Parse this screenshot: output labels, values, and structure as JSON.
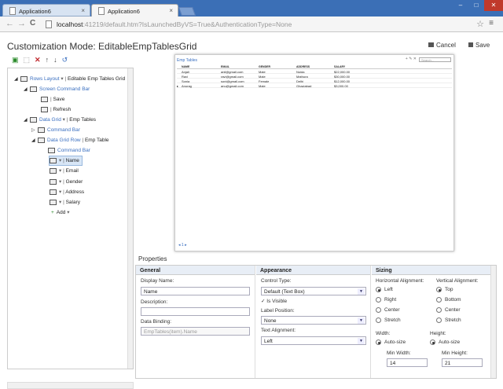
{
  "browser": {
    "tabs": [
      {
        "label": "Application6",
        "close": "×"
      },
      {
        "label": "Application6",
        "close": "×"
      }
    ],
    "url_host": "localhost",
    "url_rest": ":41219/default.htm?IsLaunchedByVS=True&AuthenticationType=None",
    "back": "←",
    "forward": "→",
    "reload": "C",
    "star": "☆",
    "menu": "≡",
    "win": {
      "min": "–",
      "max": "□",
      "close": "✕"
    }
  },
  "app": {
    "title": "Customization Mode: EditableEmpTablesGrid",
    "cancel": "Cancel",
    "save": "Save",
    "tree": {
      "rows_layout": "Rows Layout",
      "rows_layout_value": "Editable Emp Tables Grid",
      "screen_cmd_bar": "Screen Command Bar",
      "save": "Save",
      "refresh": "Refresh",
      "data_grid": "Data Grid",
      "data_grid_value": "Emp Tables",
      "command_bar": "Command Bar",
      "data_grid_row": "Data Grid Row",
      "data_grid_row_value": "Emp Table",
      "command_bar2": "Command Bar",
      "fields": [
        "Name",
        "Email",
        "Gender",
        "Address",
        "Salary"
      ],
      "add": "Add"
    }
  },
  "preview": {
    "title": "Emp Tables",
    "search": "Search...",
    "headers": [
      "NAME",
      "EMAIL",
      "GENDER",
      "ADDRESS",
      "SALARY"
    ],
    "rows": [
      [
        "Anjali",
        "anil@gmail.com",
        "Male",
        "Noida",
        "$22,000.00"
      ],
      [
        "Ravi",
        "ravi@gmail.com",
        "Male",
        "Mathura",
        "$30,000.00"
      ],
      [
        "Sonia",
        "soni@gmail.com",
        "Female",
        "Delhi",
        "$12,000.00"
      ],
      [
        "Anurag",
        "anu@gmail.com",
        "Male",
        "Ghaziabad",
        "$3,000.00"
      ]
    ],
    "page": "1"
  },
  "properties": {
    "title": "Properties",
    "general": {
      "header": "General",
      "display_name_label": "Display Name:",
      "display_name": "Name",
      "description_label": "Description:",
      "description": "",
      "data_binding_label": "Data Binding:",
      "data_binding": "EmpTables(item).Name"
    },
    "appearance": {
      "header": "Appearance",
      "control_type_label": "Control Type:",
      "control_type": "Default (Text Box)",
      "is_visible": "Is Visible",
      "label_position_label": "Label Position:",
      "label_position": "None",
      "text_alignment_label": "Text Alignment:",
      "text_alignment": "Left"
    },
    "sizing": {
      "header": "Sizing",
      "h_align_label": "Horizontal Alignment:",
      "h_align": [
        "Left",
        "Right",
        "Center",
        "Stretch"
      ],
      "v_align_label": "Vertical Alignment:",
      "v_align": [
        "Top",
        "Bottom",
        "Center",
        "Stretch"
      ],
      "width_label": "Width:",
      "width_mode": "Auto-size",
      "height_label": "Height:",
      "height_mode": "Auto-size",
      "min_width_label": "Min Width:",
      "min_width": "14",
      "min_height_label": "Min Height:",
      "min_height": "21"
    }
  }
}
